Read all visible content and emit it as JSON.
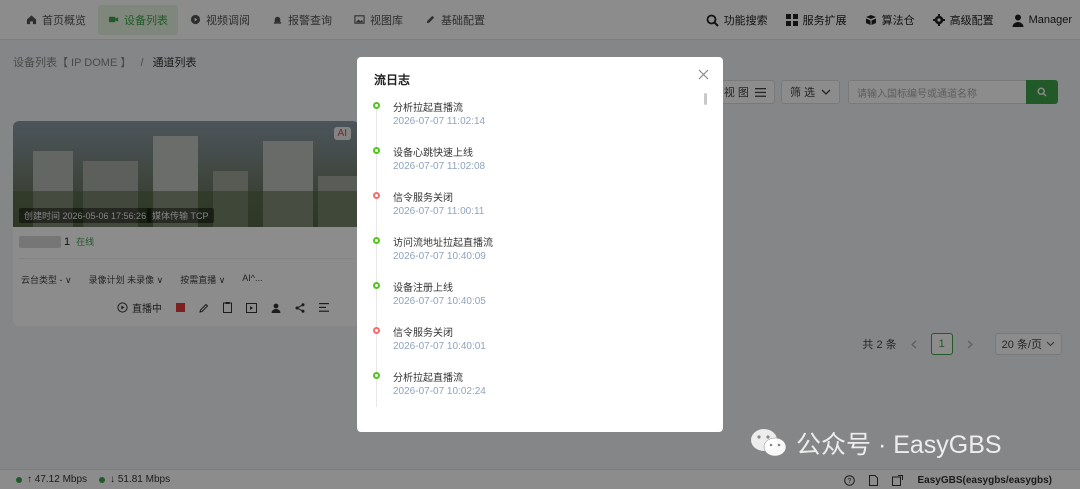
{
  "nav": {
    "items": [
      {
        "label": "首页概览",
        "icon": "home-icon",
        "active": false
      },
      {
        "label": "设备列表",
        "icon": "camera-icon",
        "active": true
      },
      {
        "label": "视频调阅",
        "icon": "play-icon",
        "active": false
      },
      {
        "label": "报警查询",
        "icon": "alarm-icon",
        "active": false
      },
      {
        "label": "视图库",
        "icon": "image-icon",
        "active": false
      },
      {
        "label": "基础配置",
        "icon": "pen-icon",
        "active": false
      }
    ],
    "right": [
      {
        "label": "功能搜索",
        "icon": "search-icon"
      },
      {
        "label": "服务扩展",
        "icon": "grid-icon"
      },
      {
        "label": "算法仓",
        "icon": "box-icon"
      },
      {
        "label": "高级配置",
        "icon": "gear-icon"
      },
      {
        "label": "Manager",
        "icon": "user-icon"
      }
    ]
  },
  "breadcrumb": {
    "parent": "设备列表【 IP DOME 】",
    "sep": "/",
    "current": "通道列表"
  },
  "toolbar": {
    "view_label": "视 图",
    "filter_label": "筛 选",
    "search_placeholder": "请输入国标编号或通道名称"
  },
  "card": {
    "ai_badge": "AI",
    "create_time": "创建时间 2026-05-06 17:56:26",
    "transport": "媒体传输 TCP",
    "name_suffix": "1",
    "status": "在线",
    "options": [
      "云台类型 - ∨",
      "录像计划 未录像 ∨",
      "按需直播 ∨",
      "AI^..."
    ],
    "live_label": "直播中"
  },
  "pager": {
    "total": "共 2 条",
    "current": "1",
    "page_size": "20 条/页"
  },
  "footer": {
    "up_rate": "↑ 47.12 Mbps",
    "down_rate": "↓ 51.81 Mbps",
    "product": "EasyGBS(easygbs/easygbs)"
  },
  "watermark": {
    "text": "公众号 · EasyGBS"
  },
  "modal": {
    "title": "流日志",
    "events": [
      {
        "label": "分析拉起直播流",
        "time": "2026-07-07 11:02:14",
        "status": "ok"
      },
      {
        "label": "设备心跳快速上线",
        "time": "2026-07-07 11:02:08",
        "status": "ok"
      },
      {
        "label": "信令服务关闭",
        "time": "2026-07-07 11:00:11",
        "status": "error"
      },
      {
        "label": "访问流地址拉起直播流",
        "time": "2026-07-07 10:40:09",
        "status": "ok"
      },
      {
        "label": "设备注册上线",
        "time": "2026-07-07 10:40:05",
        "status": "ok"
      },
      {
        "label": "信令服务关闭",
        "time": "2026-07-07 10:40:01",
        "status": "error"
      },
      {
        "label": "分析拉起直播流",
        "time": "2026-07-07 10:02:24",
        "status": "ok"
      }
    ]
  },
  "colors": {
    "accent": "#3ea34a",
    "ok": "#52c41a",
    "error": "#f56c6c"
  }
}
